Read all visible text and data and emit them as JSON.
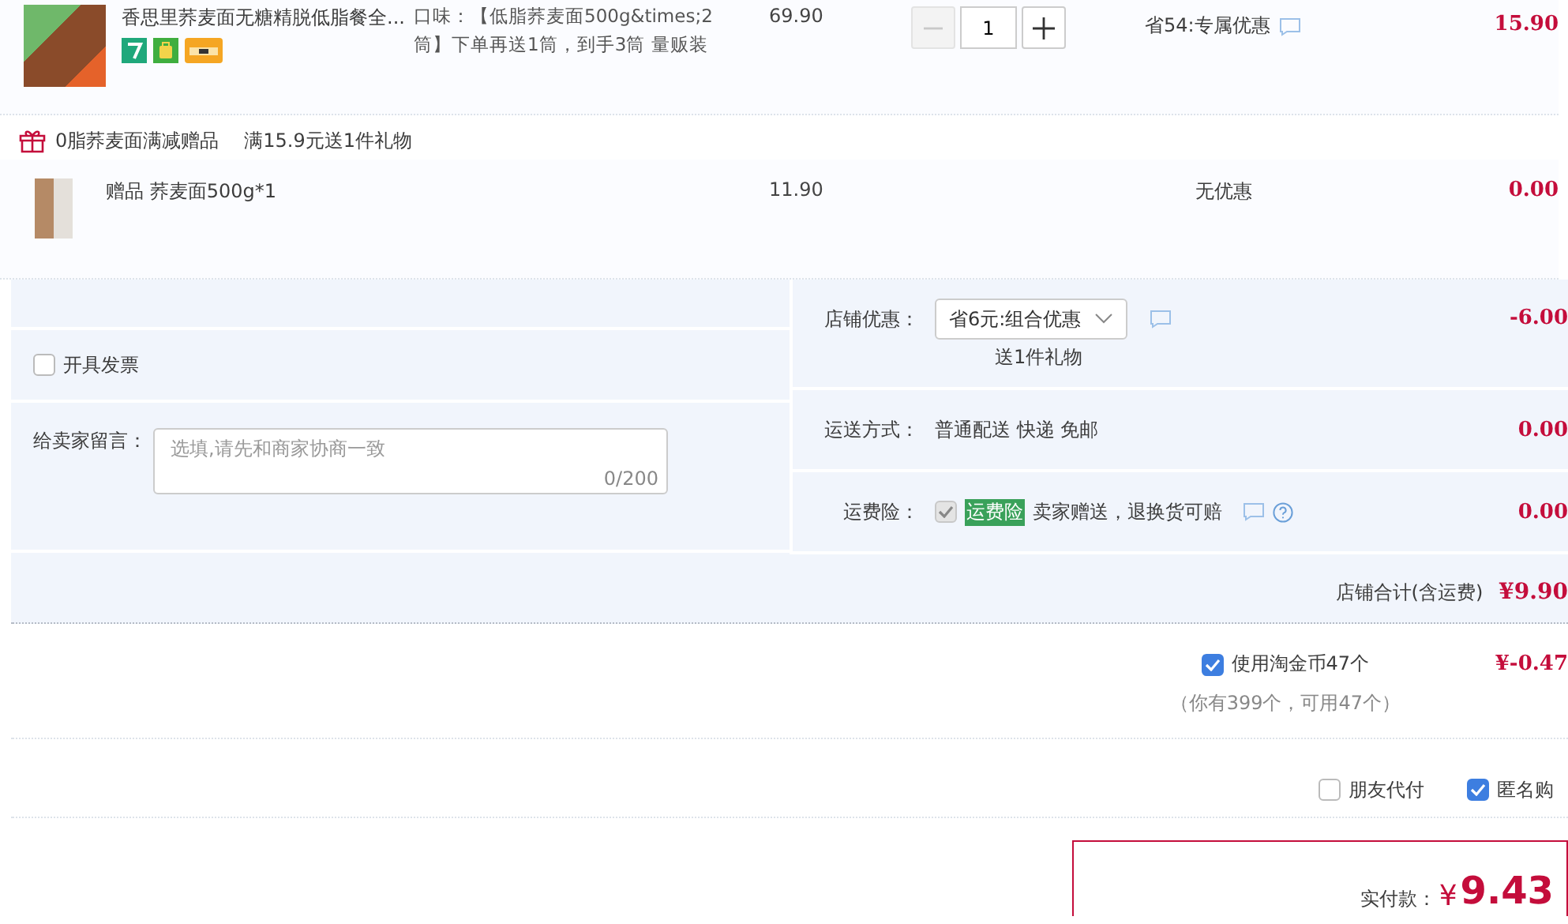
{
  "product": {
    "title": "香思里荞麦面无糖精脱低脂餐全...",
    "spec": "口味：【低脂荞麦面500g&times;2筒】下单再送1筒，到手3筒 量贩装",
    "price": "69.90",
    "quantity": "1",
    "minus_disabled": true,
    "discount": "省54:专属优惠",
    "subtotal": "15.90"
  },
  "gift_group": {
    "name": "0脂荞麦面满减赠品",
    "rule": "满15.9元送1件礼物",
    "items": [
      {
        "title": "赠品 荞麦面500g*1",
        "price": "11.90",
        "discount": "无优惠",
        "subtotal": "0.00"
      }
    ]
  },
  "invoice": {
    "label": "开具发票",
    "checked": false
  },
  "message": {
    "label": "给卖家留言：",
    "placeholder": "选填,请先和商家协商一致",
    "counter": "0/200"
  },
  "shop_discount": {
    "label": "店铺优惠：",
    "value": "省6元:组合优惠",
    "note": "送1件礼物",
    "amount": "-6.00"
  },
  "shipping": {
    "label": "运送方式：",
    "value": "普通配送 快递 免邮",
    "amount": "0.00"
  },
  "insurance": {
    "label": "运费险：",
    "checked": true,
    "disabled": true,
    "tag": "运费险",
    "text": "卖家赠送，退换货可赔",
    "amount": "0.00"
  },
  "shop_total": {
    "label": "店铺合计(含运费)",
    "amount": "¥9.90"
  },
  "coins": {
    "label": "使用淘金币47个",
    "checked": true,
    "note": "（你有399个，可用47个）",
    "amount": "¥-0.47"
  },
  "options": [
    {
      "label": "朋友代付",
      "checked": false
    },
    {
      "label": "匿名购",
      "checked": true
    }
  ],
  "pay": {
    "label": "实付款：",
    "currency": "¥",
    "amount": "9.43"
  }
}
